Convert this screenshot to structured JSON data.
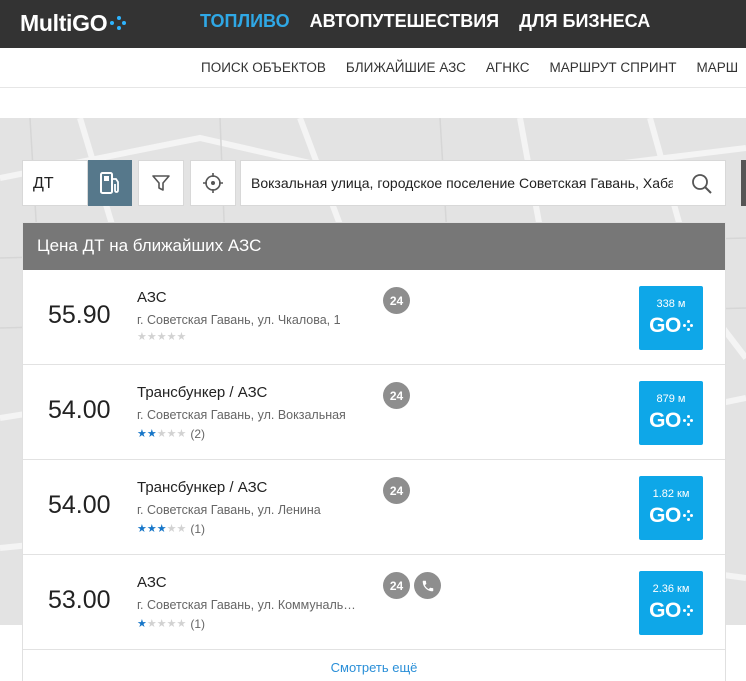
{
  "header": {
    "logo_text": "MultiGO",
    "nav": [
      {
        "label": "ТОПЛИВО",
        "active": true
      },
      {
        "label": "АВТОПУТЕШЕСТВИЯ",
        "active": false
      },
      {
        "label": "ДЛЯ БИЗНЕСА",
        "active": false
      }
    ]
  },
  "subnav": {
    "items": [
      "ПОИСК ОБЪЕКТОВ",
      "БЛИЖАЙШИЕ АЗС",
      "АГНКС",
      "МАРШРУТ СПРИНТ",
      "МАРШ"
    ]
  },
  "search": {
    "fuel_type": "ДТ",
    "address": "Вокзальная улица, городское поселение Советская Гавань, Хабаровский край",
    "icons": {
      "pump": "fuel-pump-icon",
      "filter": "filter-icon",
      "locate": "locate-icon",
      "search": "search-icon"
    }
  },
  "panel": {
    "title": "Цена ДТ на ближайших АЗС",
    "more_link": "Смотреть ещё",
    "stations": [
      {
        "price": "55.90",
        "name": "АЗС",
        "address": "г. Советская Гавань, ул. Чкалова, 1",
        "rating": 0,
        "reviews": "",
        "badge": "24",
        "phone": false,
        "distance": "338 м",
        "go_label": "GO"
      },
      {
        "price": "54.00",
        "name": "Трансбункер / АЗС",
        "address": "г. Советская Гавань, ул. Вокзальная",
        "rating": 2,
        "reviews": "(2)",
        "badge": "24",
        "phone": false,
        "distance": "879 м",
        "go_label": "GO"
      },
      {
        "price": "54.00",
        "name": "Трансбункер / АЗС",
        "address": "г. Советская Гавань, ул. Ленина",
        "rating": 2.5,
        "reviews": "(1)",
        "badge": "24",
        "phone": false,
        "distance": "1.82 км",
        "go_label": "GO"
      },
      {
        "price": "53.00",
        "name": "АЗС",
        "address": "г. Советская Гавань, ул. Коммунальная",
        "rating": 1,
        "reviews": "(1)",
        "badge": "24",
        "phone": true,
        "distance": "2.36 км",
        "go_label": "GO"
      }
    ]
  },
  "colors": {
    "topbar": "#333333",
    "active_nav": "#2fa8e6",
    "go_button": "#0ea7e8",
    "pump_button": "#56788b",
    "panel_header": "#777777"
  }
}
